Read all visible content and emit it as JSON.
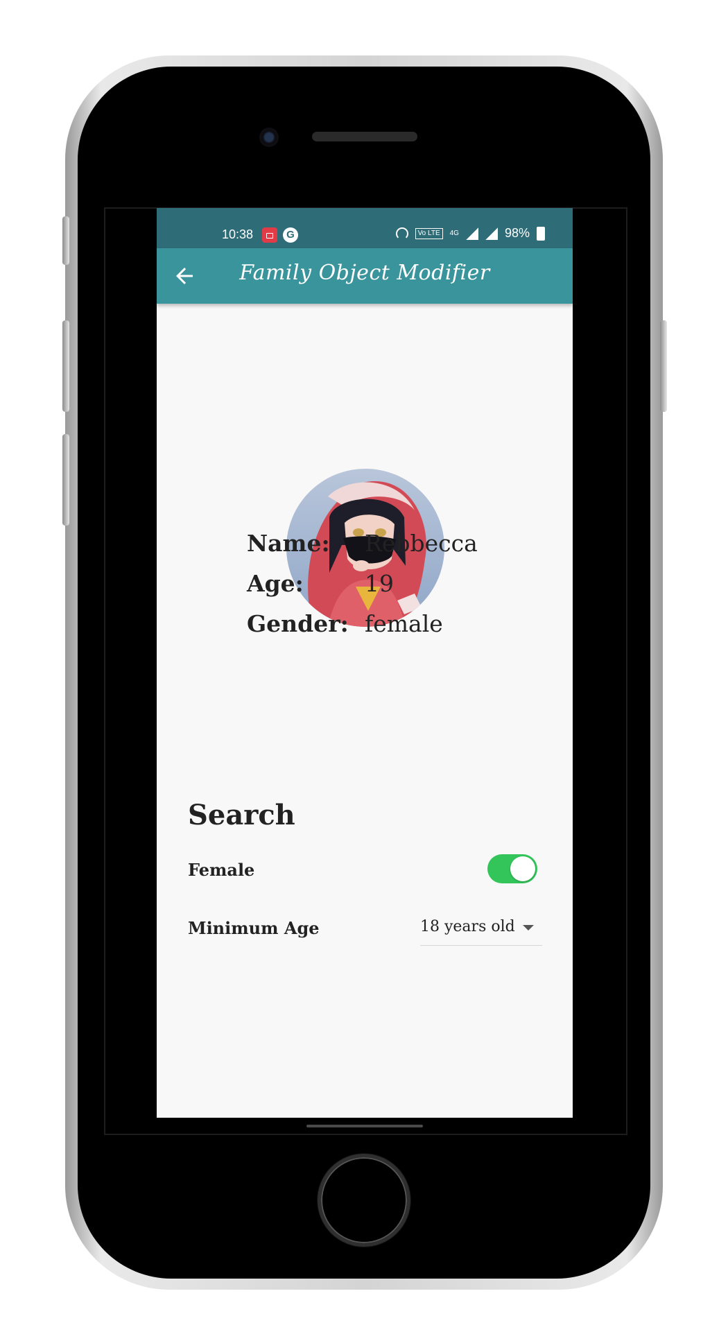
{
  "status_bar": {
    "time": "10:38",
    "battery": "98%",
    "notification_icons": [
      "screen-recorder-icon",
      "google-icon"
    ],
    "status_icons": [
      "hotspot-icon",
      "volte-icon",
      "4g-signal-icon",
      "signal-icon",
      "battery-icon"
    ],
    "network": "4G",
    "volte_label": "Vo LTE"
  },
  "app_bar": {
    "title": "Family Object Modifier",
    "back_icon": "arrow-left-icon",
    "color": "#3a949c"
  },
  "profile": {
    "avatar_icon": "profile-avatar",
    "fields": [
      {
        "label": "Name:",
        "value": "Rebbecca"
      },
      {
        "label": "Age:",
        "value": "19"
      },
      {
        "label": "Gender:",
        "value": "female"
      }
    ]
  },
  "search": {
    "heading": "Search",
    "female_toggle": {
      "label": "Female",
      "on": true,
      "color": "#33c45a"
    },
    "minimum_age": {
      "label": "Minimum Age",
      "selected": "18 years old"
    }
  }
}
